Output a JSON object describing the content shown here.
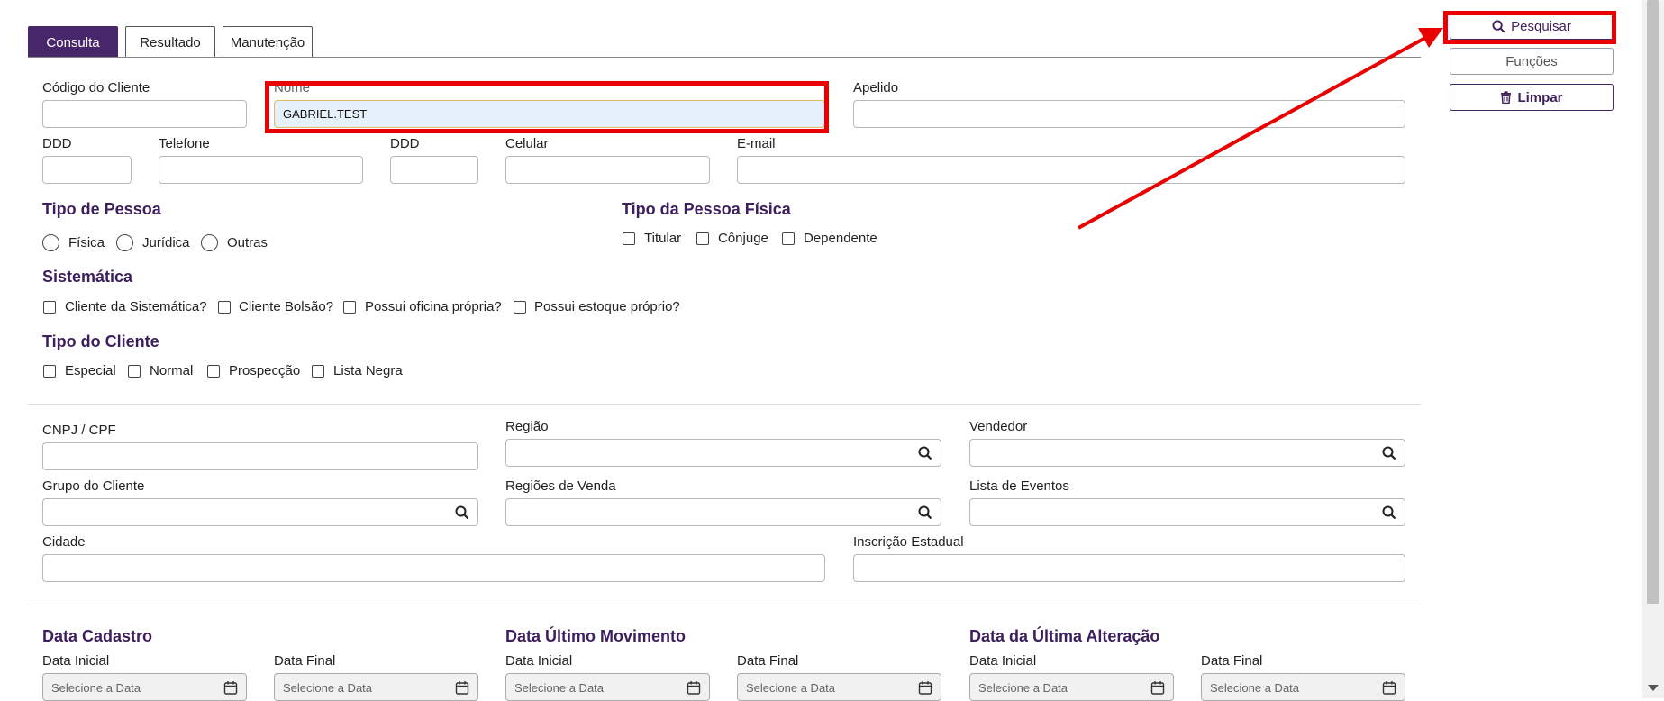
{
  "tabs": [
    "Consulta",
    "Resultado",
    "Manutenção"
  ],
  "buttons": {
    "search": "Pesquisar",
    "functions": "Funções",
    "clear": "Limpar"
  },
  "fields": {
    "codigo": {
      "label": "Código do Cliente",
      "value": ""
    },
    "nome": {
      "label": "Nome",
      "value": "GABRIEL.TEST"
    },
    "apelido": {
      "label": "Apelido",
      "value": ""
    },
    "ddd1": {
      "label": "DDD",
      "value": ""
    },
    "telefone": {
      "label": "Telefone",
      "value": ""
    },
    "ddd2": {
      "label": "DDD",
      "value": ""
    },
    "celular": {
      "label": "Celular",
      "value": ""
    },
    "email": {
      "label": "E-mail",
      "value": ""
    },
    "cnpj": {
      "label": "CNPJ / CPF"
    },
    "regiao": {
      "label": "Região"
    },
    "vendedor": {
      "label": "Vendedor"
    },
    "grupo": {
      "label": "Grupo do Cliente"
    },
    "regioes_venda": {
      "label": "Regiões de Venda"
    },
    "lista_eventos": {
      "label": "Lista de Eventos"
    },
    "cidade": {
      "label": "Cidade"
    },
    "inscricao": {
      "label": "Inscrição Estadual"
    }
  },
  "tipo_pessoa": {
    "title": "Tipo de Pessoa",
    "options": [
      "Física",
      "Jurídica",
      "Outras"
    ]
  },
  "tipo_pessoa_fisica": {
    "title": "Tipo da Pessoa Física",
    "options": [
      "Titular",
      "Cônjuge",
      "Dependente"
    ]
  },
  "sistematica": {
    "title": "Sistemática",
    "options": [
      "Cliente da Sistemática?",
      "Cliente Bolsão?",
      "Possui oficina própria?",
      "Possui estoque próprio?"
    ]
  },
  "tipo_cliente": {
    "title": "Tipo do Cliente",
    "options": [
      "Especial",
      "Normal",
      "Prospecção",
      "Lista Negra"
    ]
  },
  "datas": {
    "placeholder": "Selecione a Data",
    "inicial": "Data Inicial",
    "final": "Data Final",
    "groups": [
      "Data Cadastro",
      "Data Último Movimento",
      "Data da Última Alteração"
    ]
  },
  "colors": {
    "brand": "#472769",
    "highlight": "#ea0000"
  }
}
